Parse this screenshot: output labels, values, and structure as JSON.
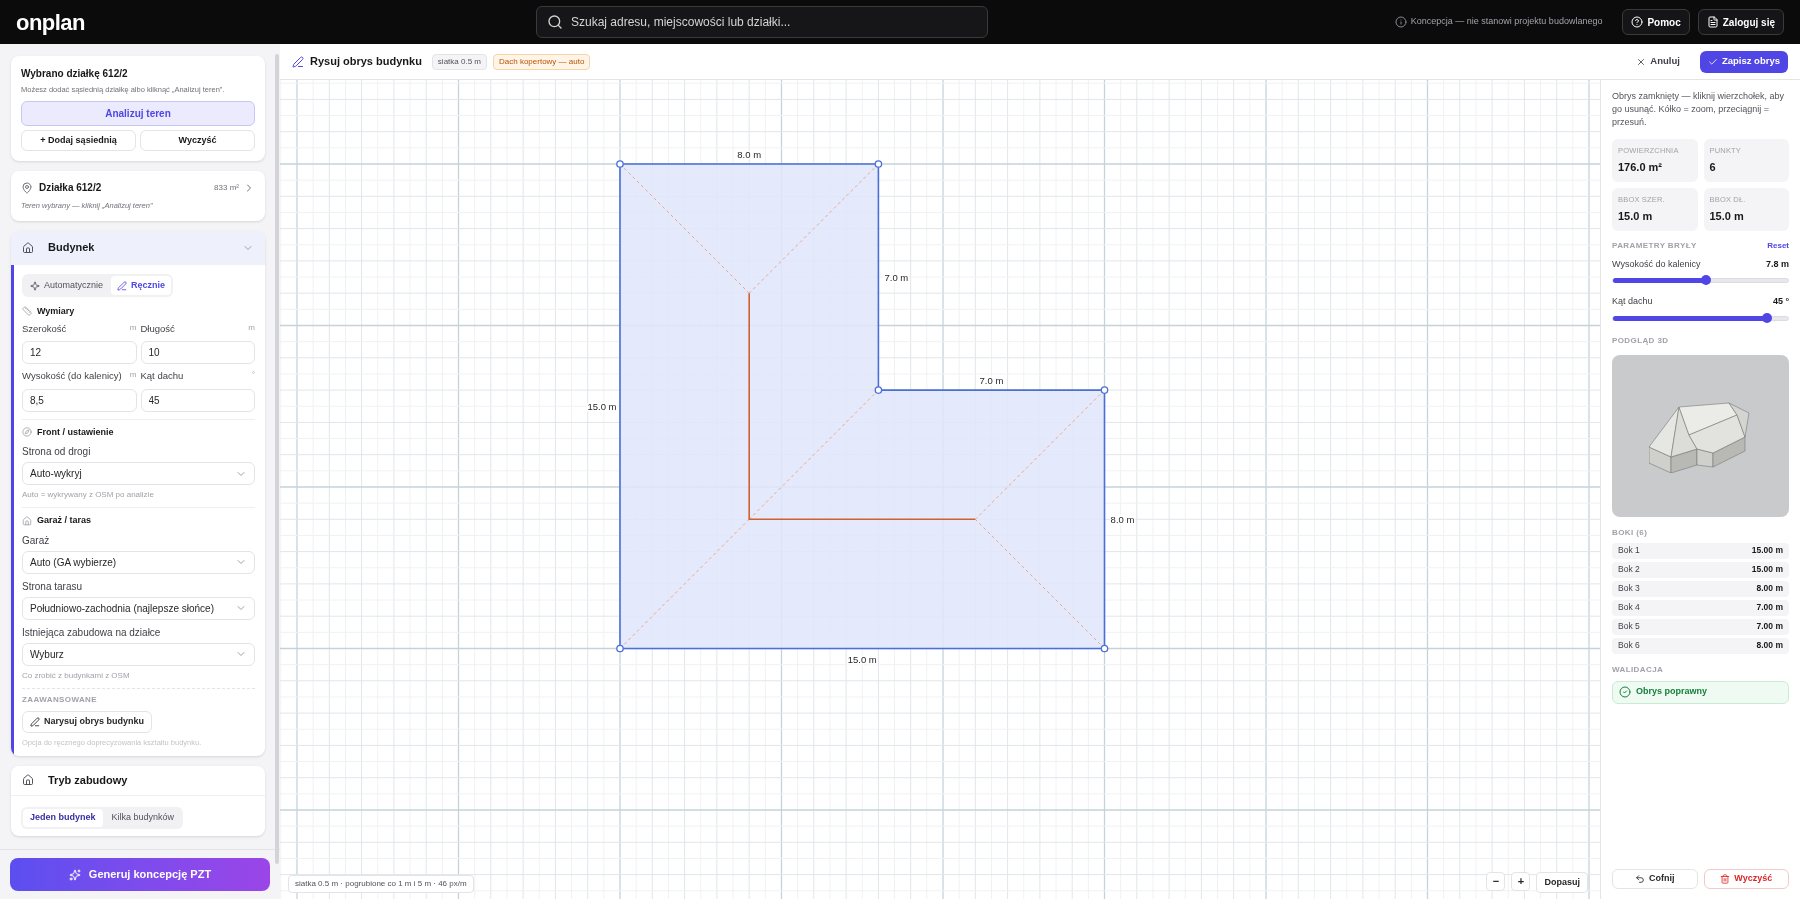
{
  "top_bar": {
    "logo": "onplan",
    "search": {
      "placeholder": "Szukaj adresu, miejscowości lub działki..."
    },
    "notice": "Koncepcja — nie stanowi projektu budowlanego",
    "buttons": [
      {
        "label": "Pomoc",
        "kind": "help"
      },
      {
        "label": "Zaloguj się",
        "kind": "login"
      }
    ]
  },
  "sidebar": {
    "selection_card": {
      "title": "Wybrano działkę 612/2",
      "hint": "Możesz dodać sąsiednią działkę albo kliknąć „Analizuj teren”.",
      "primary_button": "Analizuj teren",
      "buttons": [
        "+ Dodaj sąsiednią",
        "Wyczyść"
      ]
    },
    "parcel_card": {
      "title": "Działka 612/2",
      "area": "833 m²",
      "subtitle": "Teren wybrany — kliknij „Analizuj teren”"
    },
    "building_section": {
      "title": "Budynek",
      "expanded": true,
      "mode_tabs": [
        {
          "label": "Automatycznie",
          "kind": "auto",
          "selected": false
        },
        {
          "label": "Ręcznie",
          "kind": "manual",
          "selected": true
        }
      ],
      "dimensions": {
        "title": "Wymiary",
        "fields": [
          {
            "label": "Szerokość",
            "unit": "m",
            "value": "12"
          },
          {
            "label": "Długość",
            "unit": "m",
            "value": "10"
          },
          {
            "label": "Wysokość (do kalenicy)",
            "unit": "m",
            "value": "8,5"
          },
          {
            "label": "Kąt dachu",
            "unit": "°",
            "value": "45"
          }
        ]
      },
      "front": {
        "title": "Front / ustawienie",
        "selects": [
          {
            "label": "Strona od drogi",
            "value": "Auto-wykryj",
            "hint": "Auto = wykrywany z OSM po analizie"
          }
        ]
      },
      "garage": {
        "title": "Garaż / taras",
        "selects": [
          {
            "label": "Garaż",
            "value": "Auto (GA wybierze)"
          },
          {
            "label": "Strona tarasu",
            "value": "Południowo-zachodnia (najlepsze słońce)"
          },
          {
            "label": "Istniejąca zabudowa na działce",
            "value": "Wyburz",
            "hint": "Co zrobić z budynkami z OSM"
          }
        ]
      },
      "advanced": {
        "title": "ZAAWANSOWANE",
        "button": "Narysuj obrys budynku",
        "hint": "Opcja do ręcznego doprecyzowania kształtu budynku."
      }
    },
    "build_mode": {
      "title": "Tryb zabudowy",
      "tabs": [
        {
          "label": "Jeden budynek",
          "selected": true
        },
        {
          "label": "Kilka budynków",
          "selected": false
        }
      ]
    },
    "generate_button": "Generuj koncepcję PZT"
  },
  "editor": {
    "title": "Rysuj obrys budynku",
    "badges": [
      {
        "label": "siatka 0.5 m",
        "kind": "neutral"
      },
      {
        "label": "Dach kopertowy — auto",
        "kind": "warning"
      }
    ],
    "buttons": [
      {
        "label": "Anuluj",
        "kind": "cancel"
      },
      {
        "label": "Zapisz obrys",
        "kind": "save"
      }
    ],
    "canvas": {
      "edge_labels": [
        "8.0 m",
        "7.0 m",
        "7.0 m",
        "8.0 m",
        "15.0 m",
        "15.0 m"
      ],
      "status": "siatka 0.5 m · pogrubione co 1 m i 5 m · 46 px/m",
      "zoom_buttons": [
        "−",
        "+"
      ],
      "fit_button": "Dopasuj"
    }
  },
  "inspector": {
    "description": "Obrys zamknięty — kliknij wierzchołek, aby go usunąć. Kółko = zoom, przeciągnij = przesuń.",
    "stats": [
      {
        "label": "POWIERZCHNIA",
        "value": "176.0 m²"
      },
      {
        "label": "PUNKTY",
        "value": "6"
      },
      {
        "label": "BBOX SZER.",
        "value": "15.0 m"
      },
      {
        "label": "BBOX DŁ.",
        "value": "15.0 m"
      }
    ],
    "params_title": "PARAMETRY BRYŁY",
    "reset": "Reset",
    "sliders": [
      {
        "label": "Wysokość do kalenicy",
        "reading": "7.8 m",
        "level": 0.53
      },
      {
        "label": "Kąt dachu",
        "reading": "45 °",
        "level": 0.88
      }
    ],
    "preview_title": "PODGLĄD 3D",
    "sides_title": "BOKI (6)",
    "sides": [
      {
        "name": "Bok 1",
        "length": "15.00 m"
      },
      {
        "name": "Bok 2",
        "length": "15.00 m"
      },
      {
        "name": "Bok 3",
        "length": "8.00 m"
      },
      {
        "name": "Bok 4",
        "length": "7.00 m"
      },
      {
        "name": "Bok 5",
        "length": "7.00 m"
      },
      {
        "name": "Bok 6",
        "length": "8.00 m"
      }
    ],
    "validation_title": "WALIDACJA",
    "validation": {
      "message": "Obrys poprawny",
      "valid": true
    },
    "buttons": [
      {
        "label": "Cofnij",
        "kind": "undo"
      },
      {
        "label": "Wyczyść",
        "kind": "clear"
      }
    ]
  }
}
